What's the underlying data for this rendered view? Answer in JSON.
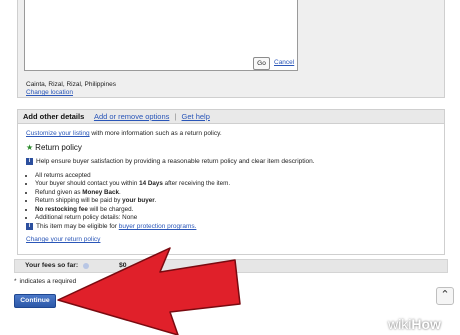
{
  "location_section": {
    "go_label": "Go",
    "cancel_label": "Cancel",
    "location": "Cainta, Rizal, Rizal, Philippines",
    "change_location": "Change location"
  },
  "details": {
    "title": "Add other details",
    "add_remove": "Add or remove options",
    "separator": "|",
    "get_help": "Get help",
    "customize_link": "Customize your listing",
    "customize_rest": " with more information such as a return policy.",
    "return_policy_title": "Return policy",
    "help_text": "Help ensure buyer satisfaction by providing a reasonable return policy and clear item description.",
    "bullets": [
      {
        "pre": "All returns accepted",
        "bold": "",
        "post": ""
      },
      {
        "pre": "Your buyer should contact you within ",
        "bold": "14 Days",
        "post": " after receiving the item."
      },
      {
        "pre": "Refund given as ",
        "bold": "Money Back",
        "post": "."
      },
      {
        "pre": "Return shipping will be paid by ",
        "bold": "your buyer",
        "post": "."
      },
      {
        "pre": "",
        "bold": "No restocking fee",
        "post": " will be charged."
      },
      {
        "pre": "Additional return policy details: None",
        "bold": "",
        "post": ""
      }
    ],
    "eligible_text": "This item may be eligible for ",
    "eligible_link": "buyer protection programs.",
    "change_policy": "Change your return policy"
  },
  "footer": {
    "fees_label": "Your fees so far:",
    "fees_amount": "$0",
    "required_text": "indicates a required",
    "required_asterisk": "*",
    "continue_label": "Continue",
    "scroll_top_icon": "chevron-up"
  },
  "overlay": {
    "arrow_color": "#e0202a",
    "watermark_wiki": "wiki",
    "watermark_how": "How"
  }
}
